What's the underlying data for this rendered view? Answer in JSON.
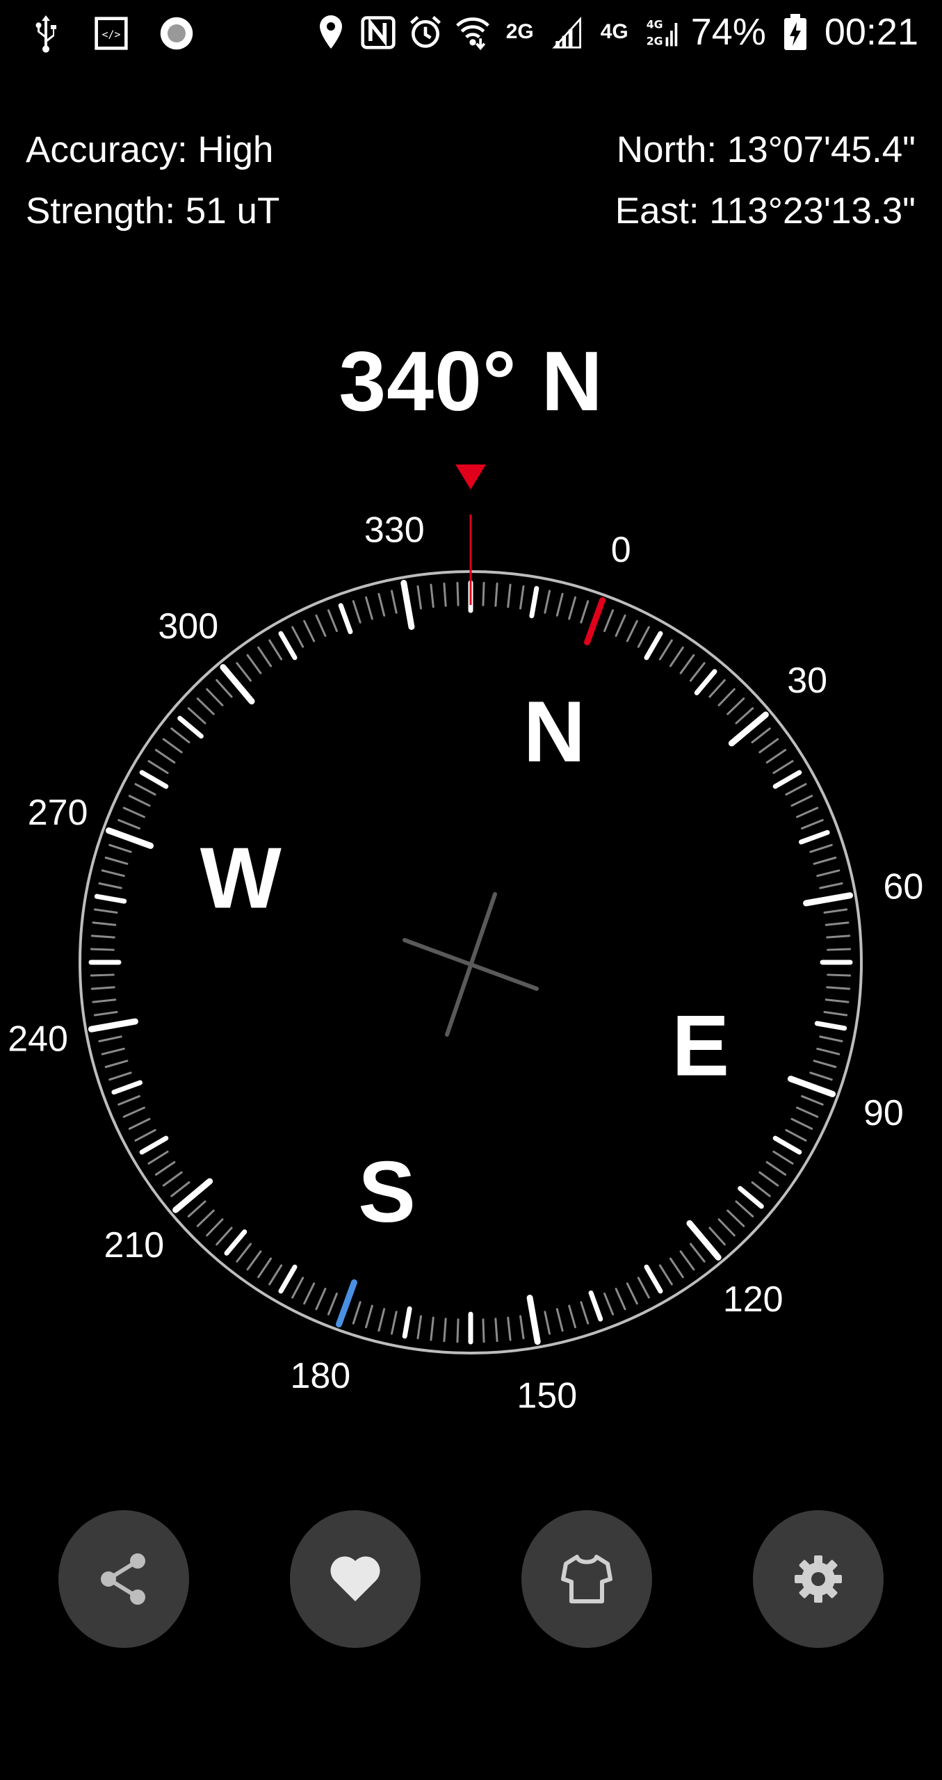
{
  "status_bar": {
    "left_icons": [
      "usb-icon",
      "developer-options-icon",
      "record-icon"
    ],
    "right_icons": [
      "location-icon",
      "nfc-icon",
      "alarm-icon",
      "wifi-icon",
      "signal-2g-icon",
      "signal-bars-icon",
      "signal-4g-icon",
      "signal-4g-2g-icon",
      "battery-charging-icon"
    ],
    "network_2g": "2G",
    "network_4g": "4G",
    "battery": "74%",
    "time": "00:21"
  },
  "info": {
    "accuracy": "Accuracy: High",
    "strength": "Strength: 51 uT",
    "north": "North: 13°07'45.4\"",
    "east": "East: 113°23'13.3\""
  },
  "heading": {
    "text": "340° N",
    "degrees": 340
  },
  "compass": {
    "degree_labels": [
      "0",
      "30",
      "60",
      "90",
      "120",
      "150",
      "180",
      "210",
      "240",
      "270",
      "300",
      "330"
    ],
    "cardinals": [
      "N",
      "E",
      "S",
      "W"
    ],
    "north_marker_color": "#e0001b",
    "south_marker_color": "#4a90e2",
    "pointer_color": "#e0001b"
  },
  "buttons": [
    {
      "name": "share-button",
      "icon": "share-icon"
    },
    {
      "name": "favorite-button",
      "icon": "heart-icon"
    },
    {
      "name": "theme-button",
      "icon": "shirt-icon"
    },
    {
      "name": "settings-button",
      "icon": "gear-icon"
    }
  ]
}
